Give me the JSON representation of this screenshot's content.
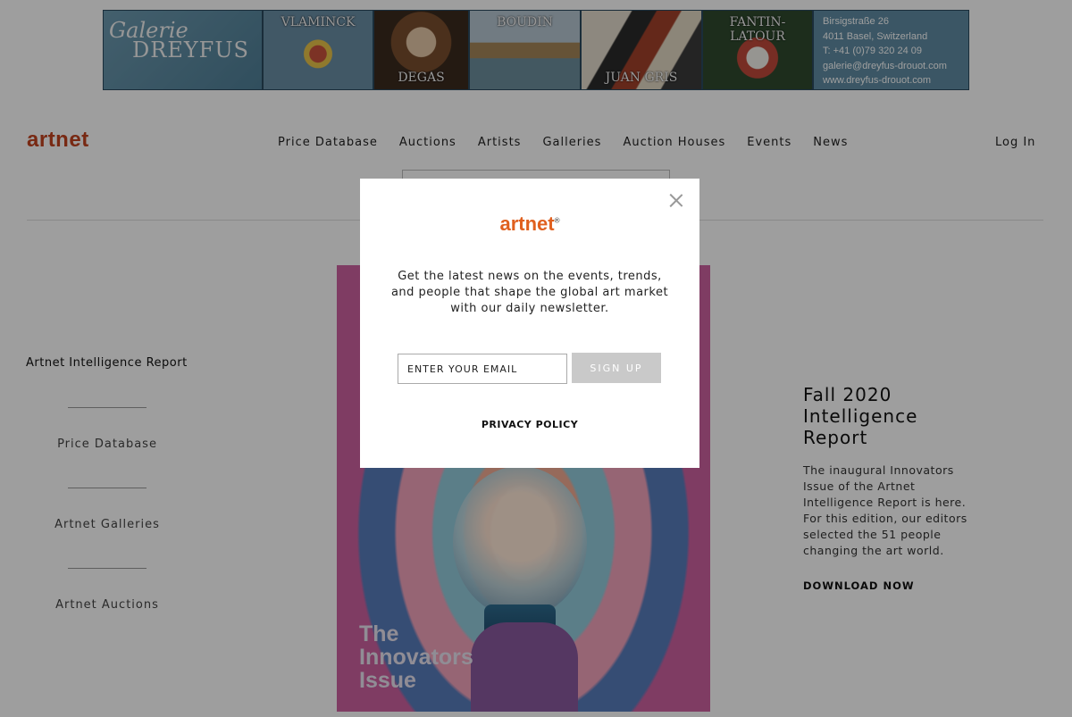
{
  "banner": {
    "gallery_script": "Galerie",
    "gallery_name": "DREYFUS",
    "artists": [
      "VLAMINCK",
      "DEGAS",
      "BOUDIN",
      "JUAN GRIS",
      "FANTIN-LATOUR"
    ],
    "address": [
      "Birsigstraße 26",
      "4011 Basel, Switzerland",
      "T: +41 (0)79 320 24 09",
      "galerie@dreyfus-drouot.com",
      "www.dreyfus-drouot.com"
    ]
  },
  "header": {
    "brand": "artnet",
    "nav": [
      "Price Database",
      "Auctions",
      "Artists",
      "Galleries",
      "Auction Houses",
      "Events",
      "News"
    ],
    "login": "Log In"
  },
  "left": {
    "title": "Artnet Intelligence Report",
    "links": [
      "Price Database",
      "Artnet Galleries",
      "Artnet Auctions"
    ]
  },
  "cover": {
    "line1": "The",
    "line2": "Innovators",
    "line3": "Issue"
  },
  "right": {
    "title": "Fall 2020 Intelligence Report",
    "description": "The inaugural Innovators Issue of the Artnet Intelligence Report is here. For this edition, our editors selected the 51 people changing the art world.",
    "download": "DOWNLOAD NOW"
  },
  "modal": {
    "logo": "artnet",
    "registered": "®",
    "text": "Get the latest news on the events, trends, and people that shape the global art market with our daily newsletter.",
    "email_placeholder": "ENTER YOUR EMAIL",
    "signup": "SIGN UP",
    "privacy": "PRIVACY POLICY"
  },
  "colors": {
    "brand": "#c2431f",
    "modal_logo": "#e0601f",
    "button": "#c9c9c9"
  }
}
